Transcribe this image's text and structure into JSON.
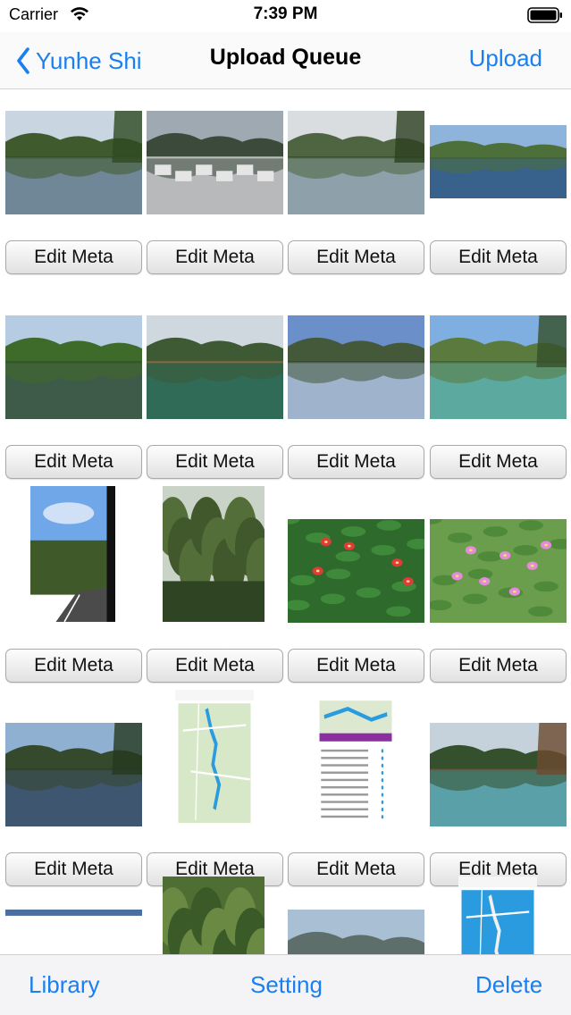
{
  "status": {
    "carrier": "Carrier",
    "time": "7:39 PM"
  },
  "nav": {
    "back_label": "Yunhe Shi",
    "title": "Upload Queue",
    "upload_label": "Upload"
  },
  "button_label": "Edit Meta",
  "photos": [
    {
      "kind": "lake-mountains"
    },
    {
      "kind": "village-mist"
    },
    {
      "kind": "lake-pagoda"
    },
    {
      "kind": "lake-wide"
    },
    {
      "kind": "hill-reflection"
    },
    {
      "kind": "green-lake-slope"
    },
    {
      "kind": "river-blue-sky"
    },
    {
      "kind": "lake-trees"
    },
    {
      "kind": "road-portrait"
    },
    {
      "kind": "forest-portrait"
    },
    {
      "kind": "red-flowers"
    },
    {
      "kind": "pink-flowers"
    },
    {
      "kind": "lake-dusk"
    },
    {
      "kind": "map-screenshot"
    },
    {
      "kind": "route-screenshot"
    },
    {
      "kind": "forest-lake"
    },
    {
      "kind": "partial"
    },
    {
      "kind": "partial-forest"
    },
    {
      "kind": "partial-mountain"
    },
    {
      "kind": "partial-screenshot"
    }
  ],
  "toolbar": {
    "library_label": "Library",
    "setting_label": "Setting",
    "delete_label": "Delete"
  },
  "colors": {
    "accent": "#1a7ff0"
  }
}
